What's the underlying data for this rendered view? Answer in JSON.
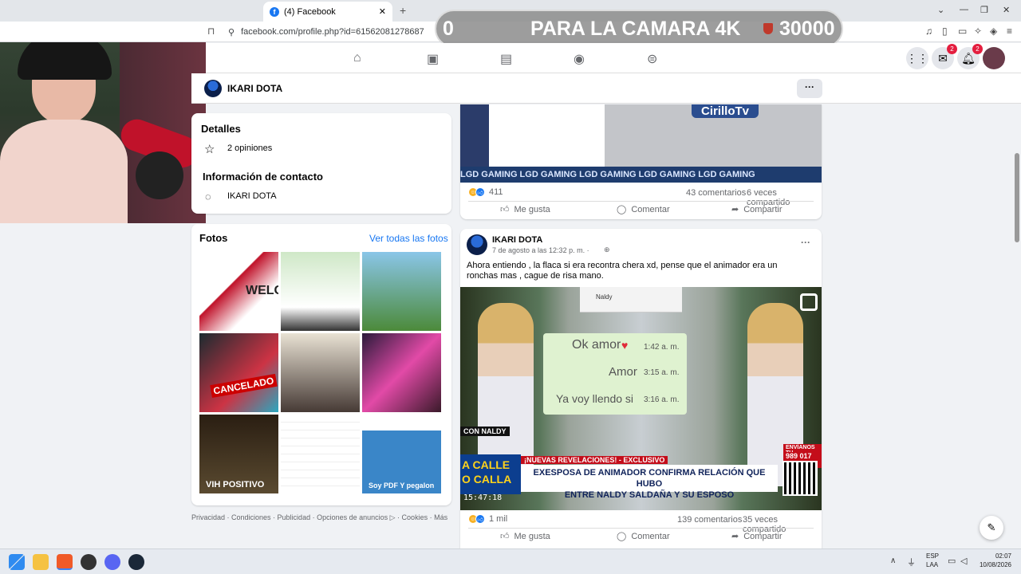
{
  "browser": {
    "tab_title": "(4) Facebook",
    "url": "facebook.com/profile.php?id=61562081278687"
  },
  "stream_overlay": {
    "left_count": "0",
    "title": "PARA LA CAMARA 4K",
    "goal": "30000"
  },
  "profile": {
    "name": "IKARI DOTA"
  },
  "about": {
    "details_heading": "Detalles",
    "reviews": "2 opiniones",
    "contact_heading": "Información de contacto",
    "messenger_name": "IKARI DOTA"
  },
  "photos": {
    "heading": "Fotos",
    "see_all": "Ver todas las fotos",
    "captions": [
      "WELC",
      "",
      "",
      "CANCELADO",
      "",
      "",
      "VIH POSITIVO",
      "",
      "Soy PDF Y pegalon"
    ]
  },
  "footer_links": "Privacidad · Condiciones · Publicidad · Opciones de anuncios ▷ · Cookies · Más",
  "post1": {
    "banner": "LGD GAMING   LGD GAMING   LGD GAMING   LGD GAMING   LGD GAMING",
    "logo": "CirilloTv",
    "reactions": "411",
    "comments": "43 comentarios",
    "shares": "6 veces compartido",
    "like": "Me gusta",
    "comment": "Comentar",
    "share": "Compartir"
  },
  "post2": {
    "author": "IKARI DOTA",
    "date": "7 de agosto a las 12:32 p. m. ·",
    "text": "Ahora entiendo , la flaca si era recontra chera xd, pense que el animador era un ronchas mas , cague de risa mano.",
    "chat_name": "Naldy",
    "msg1": "Ok amor",
    "msg1_time": "1:42 a. m.",
    "msg2": "Amor",
    "msg2_time": "3:15 a. m.",
    "msg3": "Ya voy llendo si",
    "msg3_time": "3:16 a. m.",
    "tag": "¡NUEVAS REVELACIONES! - EXCLUSIVO",
    "headline1": "EXESPOSA DE ANIMADOR CONFIRMA RELACIÓN QUE HUBO",
    "headline2": "ENTRE NALDY SALDAÑA Y SU ESPOSO",
    "side_left1": "A CALLE",
    "side_left2": "O CALLA",
    "con_naldy": "CON NALDY",
    "send_label": "ENVÍANOS TU",
    "phone": "989 017 242",
    "timestamp": "15:47:18",
    "reactions": "1 mil",
    "comments": "139 comentarios",
    "shares": "35 veces compartido",
    "like": "Me gusta",
    "comment": "Comentar",
    "share": "Compartir"
  },
  "taskbar": {
    "lang1": "ESP",
    "lang2": "LAA",
    "time": "02:07",
    "date": "10/08/2026"
  },
  "badges": {
    "messenger": "2",
    "notifications": "2"
  }
}
